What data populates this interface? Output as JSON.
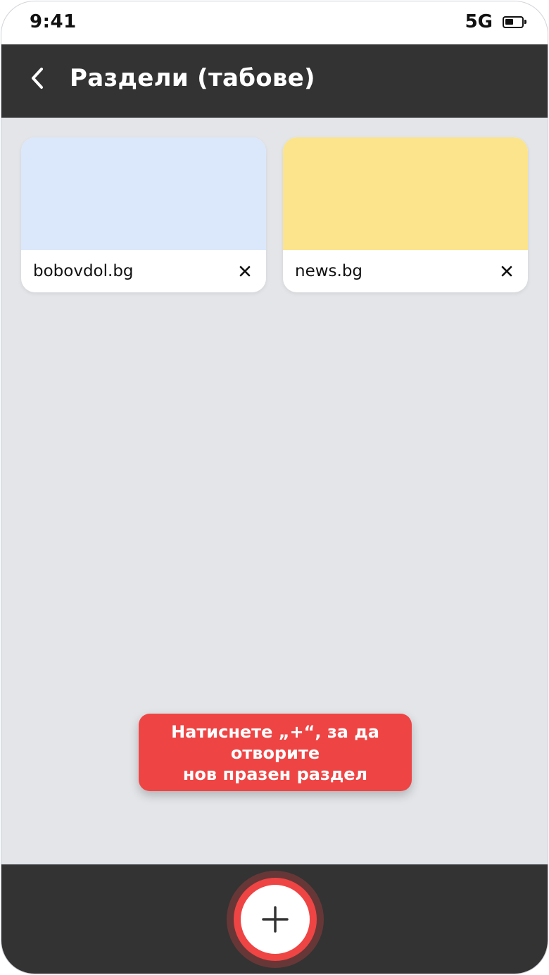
{
  "status_bar": {
    "time": "9:41",
    "network": "5G",
    "battery_level": 0.5
  },
  "header": {
    "title": "Раздели (табове)",
    "back_icon": "chevron-left-icon"
  },
  "tabs": [
    {
      "label": "bobovdol.bg",
      "preview_color": "#dbe7fb",
      "close_icon": "close-icon"
    },
    {
      "label": "news.bg",
      "preview_color": "#fbe48b",
      "close_icon": "close-icon"
    }
  ],
  "hint": {
    "text": "Натиснете „+“, за да\nотворите\nнов празен раздел"
  },
  "bottom_bar": {
    "add_icon": "plus-icon"
  },
  "colors": {
    "accent": "#ef4444",
    "bar_background": "#333333",
    "content_background": "#e3e5e9"
  }
}
